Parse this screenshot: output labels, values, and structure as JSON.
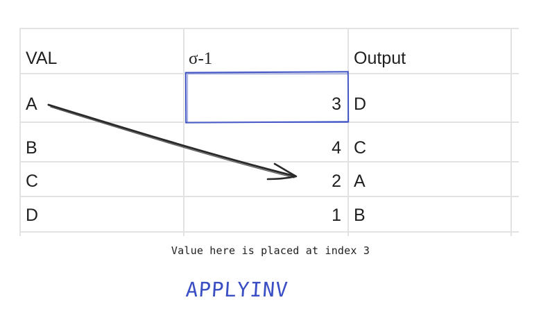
{
  "table": {
    "headers": [
      "VAL",
      "σ-1",
      "Output"
    ],
    "rows": [
      {
        "val": "A",
        "sigma_inv": "3",
        "output": "D"
      },
      {
        "val": "B",
        "sigma_inv": "4",
        "output": "C"
      },
      {
        "val": "C",
        "sigma_inv": "2",
        "output": "A"
      },
      {
        "val": "D",
        "sigma_inv": "1",
        "output": "B"
      }
    ]
  },
  "annotation": {
    "note": "Value here is placed at index 3",
    "function_name": "APPLYINV",
    "arrow_from": "A",
    "arrow_to_index": "2"
  },
  "colors": {
    "grid": "#e2e2e2",
    "text": "#1f1f1f",
    "highlight": "#3b4fc4",
    "arrow": "#2a2a2a"
  }
}
